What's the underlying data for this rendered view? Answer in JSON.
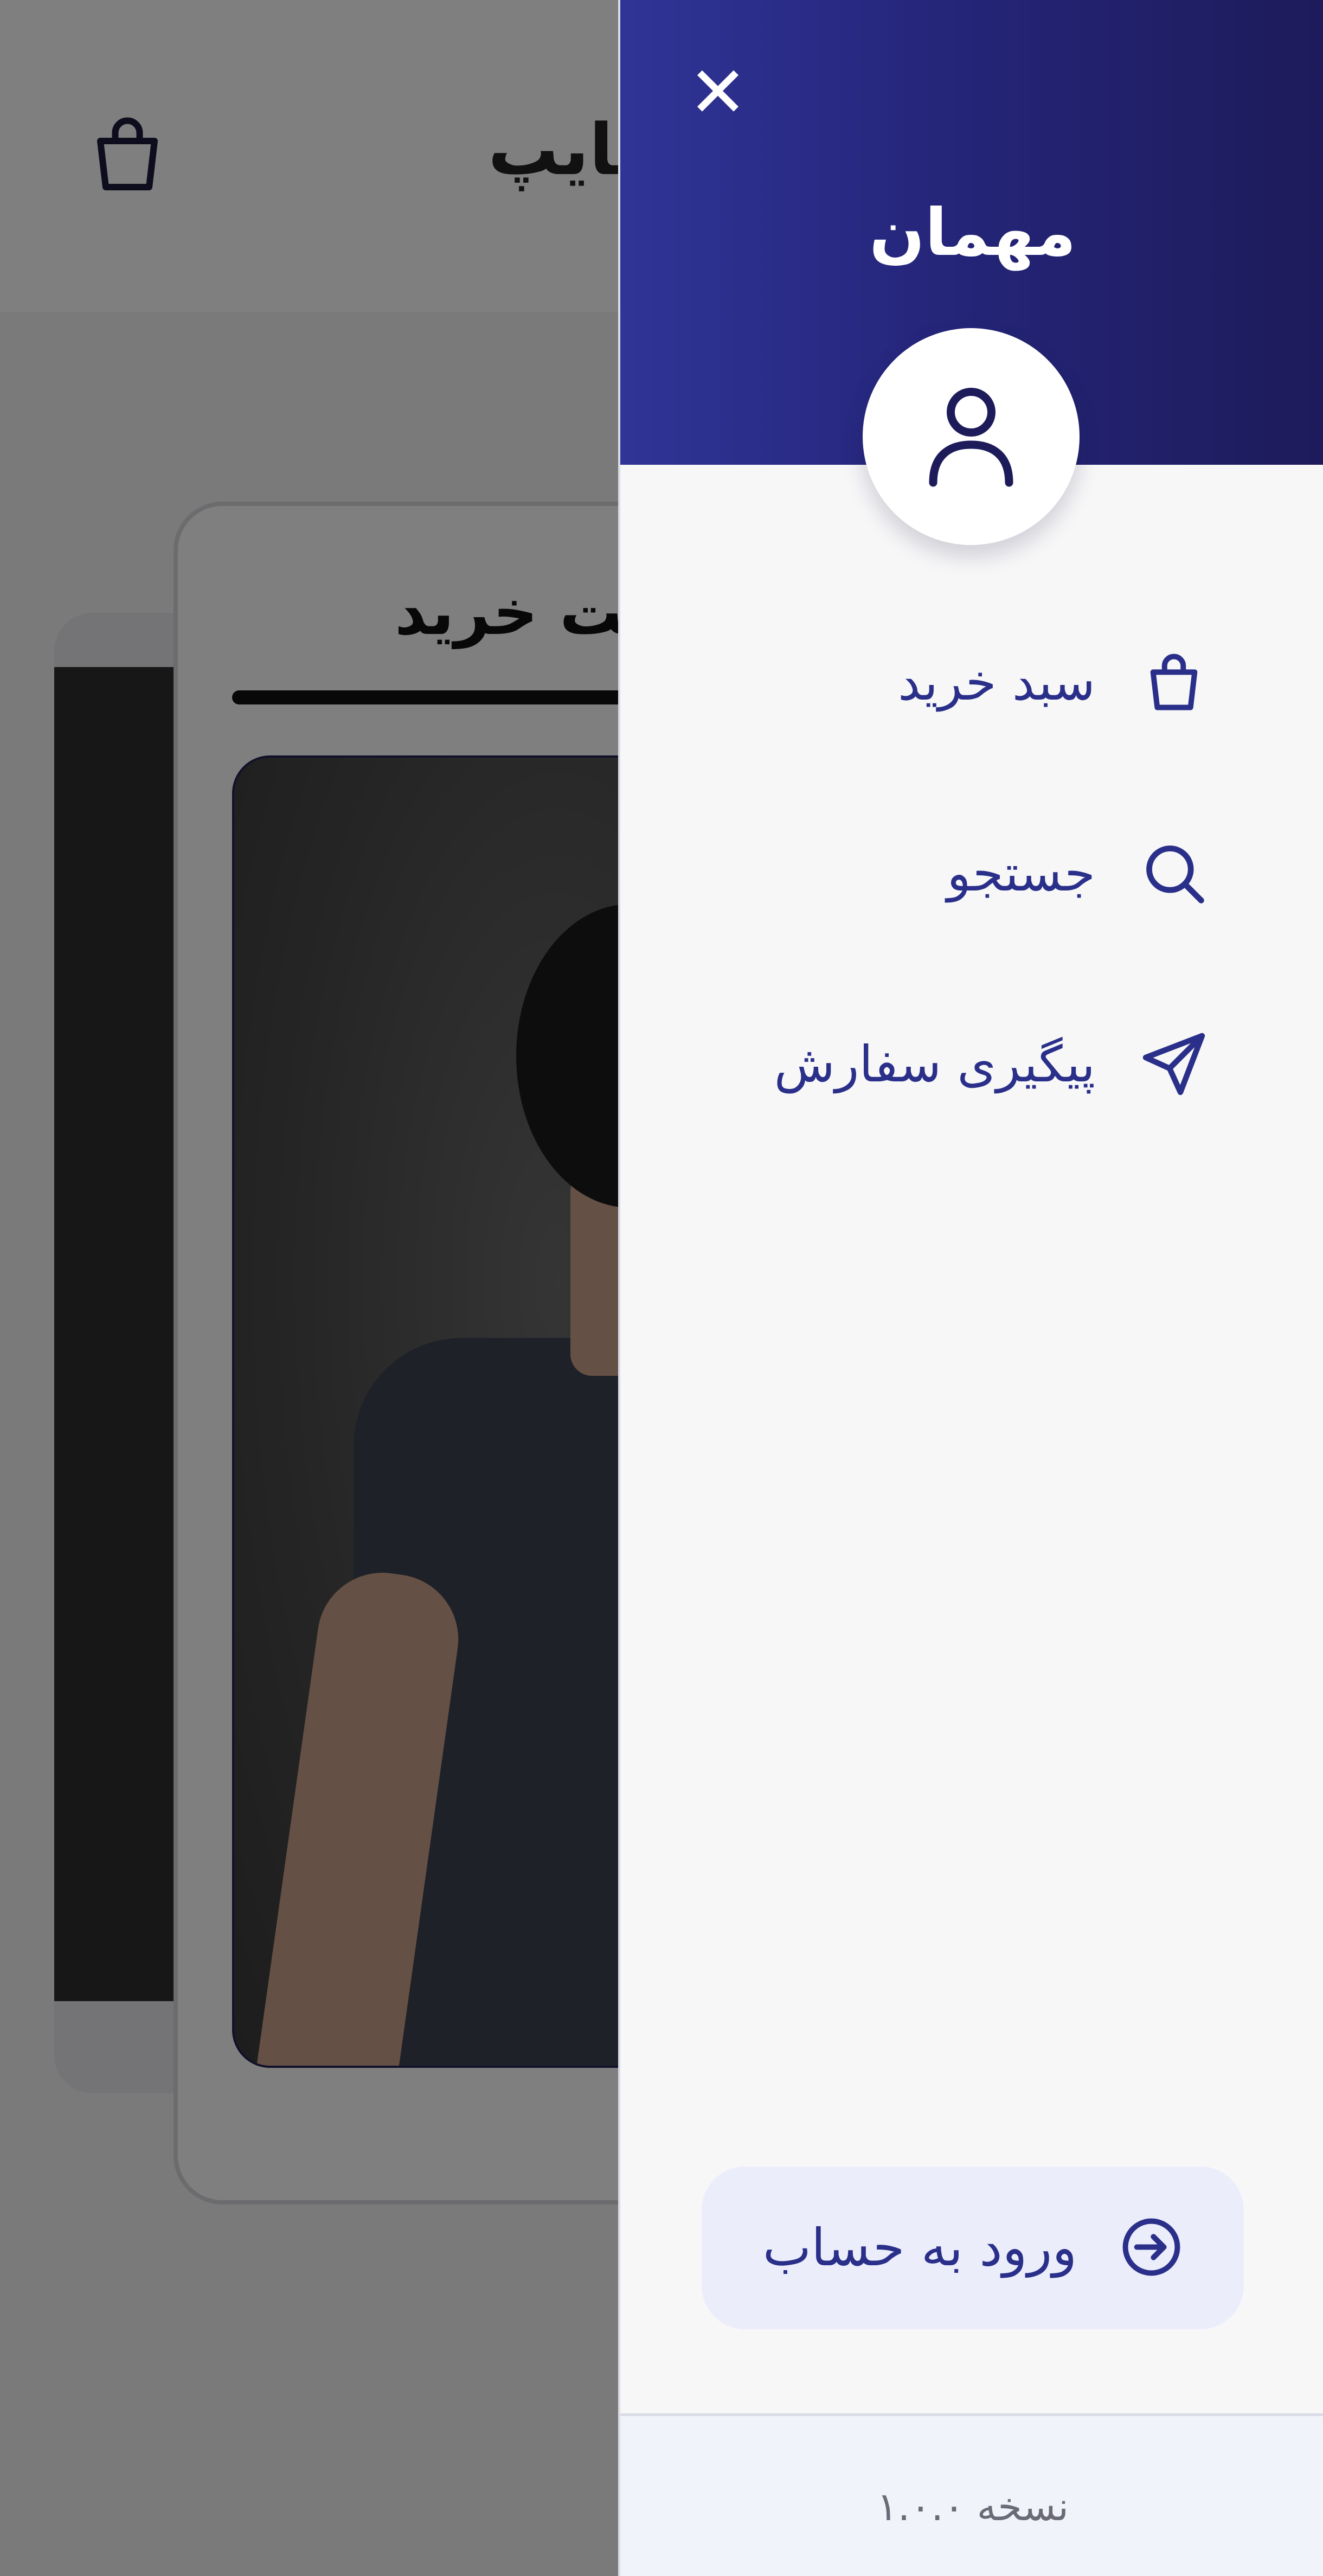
{
  "page": {
    "brand_text": "سایپ",
    "card_title": "ست خرید"
  },
  "drawer": {
    "close_symbol": "✕",
    "guest_name": "مهمان",
    "menu": [
      {
        "label": "سبد خرید",
        "icon": "shopping-bag-icon"
      },
      {
        "label": "جستجو",
        "icon": "search-icon"
      },
      {
        "label": "پیگیری سفارش",
        "icon": "send-icon"
      }
    ],
    "login_label": "ورود به حساب",
    "version": "نسخه ۱.۰.۰"
  },
  "colors": {
    "accent": "#2a2f8a",
    "header_gradient_start": "#2f3496",
    "header_gradient_end": "#1d1b5a",
    "login_bg": "#ecedfb",
    "overlay": "rgba(0,0,0,0.5)"
  }
}
